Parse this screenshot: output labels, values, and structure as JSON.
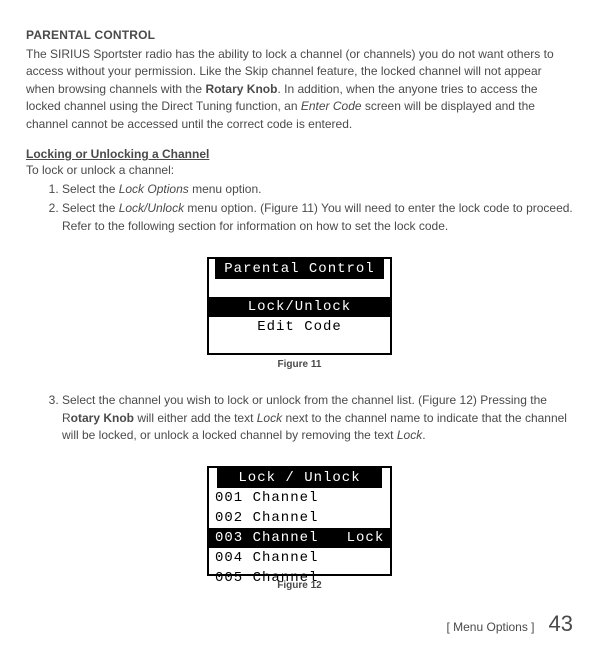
{
  "heading": "PARENTAL CONTROL",
  "intro_pre": "The SIRIUS Sportster radio has the ability to lock a channel (or channels) you do not want others to access without your permission. Like the Skip channel feature, the locked channel will not appear when browsing channels with the ",
  "intro_bold": "Rotary Knob",
  "intro_mid": ". In addition, when the anyone tries to access the locked channel using the Direct Tuning function, an ",
  "intro_italic": "Enter Code",
  "intro_post": " screen will be displayed and the channel cannot be accessed until the correct code is entered.",
  "sub_heading": "Locking or Unlocking a Channel",
  "lead": "To lock or unlock a channel:",
  "step1_pre": "Select the ",
  "step1_italic": "Lock Options",
  "step1_post": " menu option.",
  "step2_pre": "Select the ",
  "step2_italic": "Lock/Unlock",
  "step2_post": " menu option. (Figure 11) You will need to enter the lock code to proceed. Refer to the following section for information on how to set the lock code.",
  "fig11": {
    "title": "Parental Control",
    "line1": "Lock/Unlock",
    "line2": "Edit Code",
    "caption": "Figure 11"
  },
  "step3_pre": "Select the channel you wish to lock or unlock from the channel list. (Figure 12) Pressing the R",
  "step3_bold": "otary Knob",
  "step3_mid": " will either add the text ",
  "step3_italic1": "Lock",
  "step3_mid2": " next to the channel name to indicate that the channel will be locked, or unlock a locked channel by removing the text ",
  "step3_italic2": "Lock",
  "step3_post": ".",
  "fig12": {
    "title": "Lock / Unlock",
    "r1": "001 Channel",
    "r2": "002 Channel",
    "r3": "003 Channel   Lock",
    "r4": "004 Channel",
    "r5": "005 Channel",
    "caption": "Figure 12"
  },
  "footer_label": "[ Menu Options ]",
  "page_num": "43"
}
